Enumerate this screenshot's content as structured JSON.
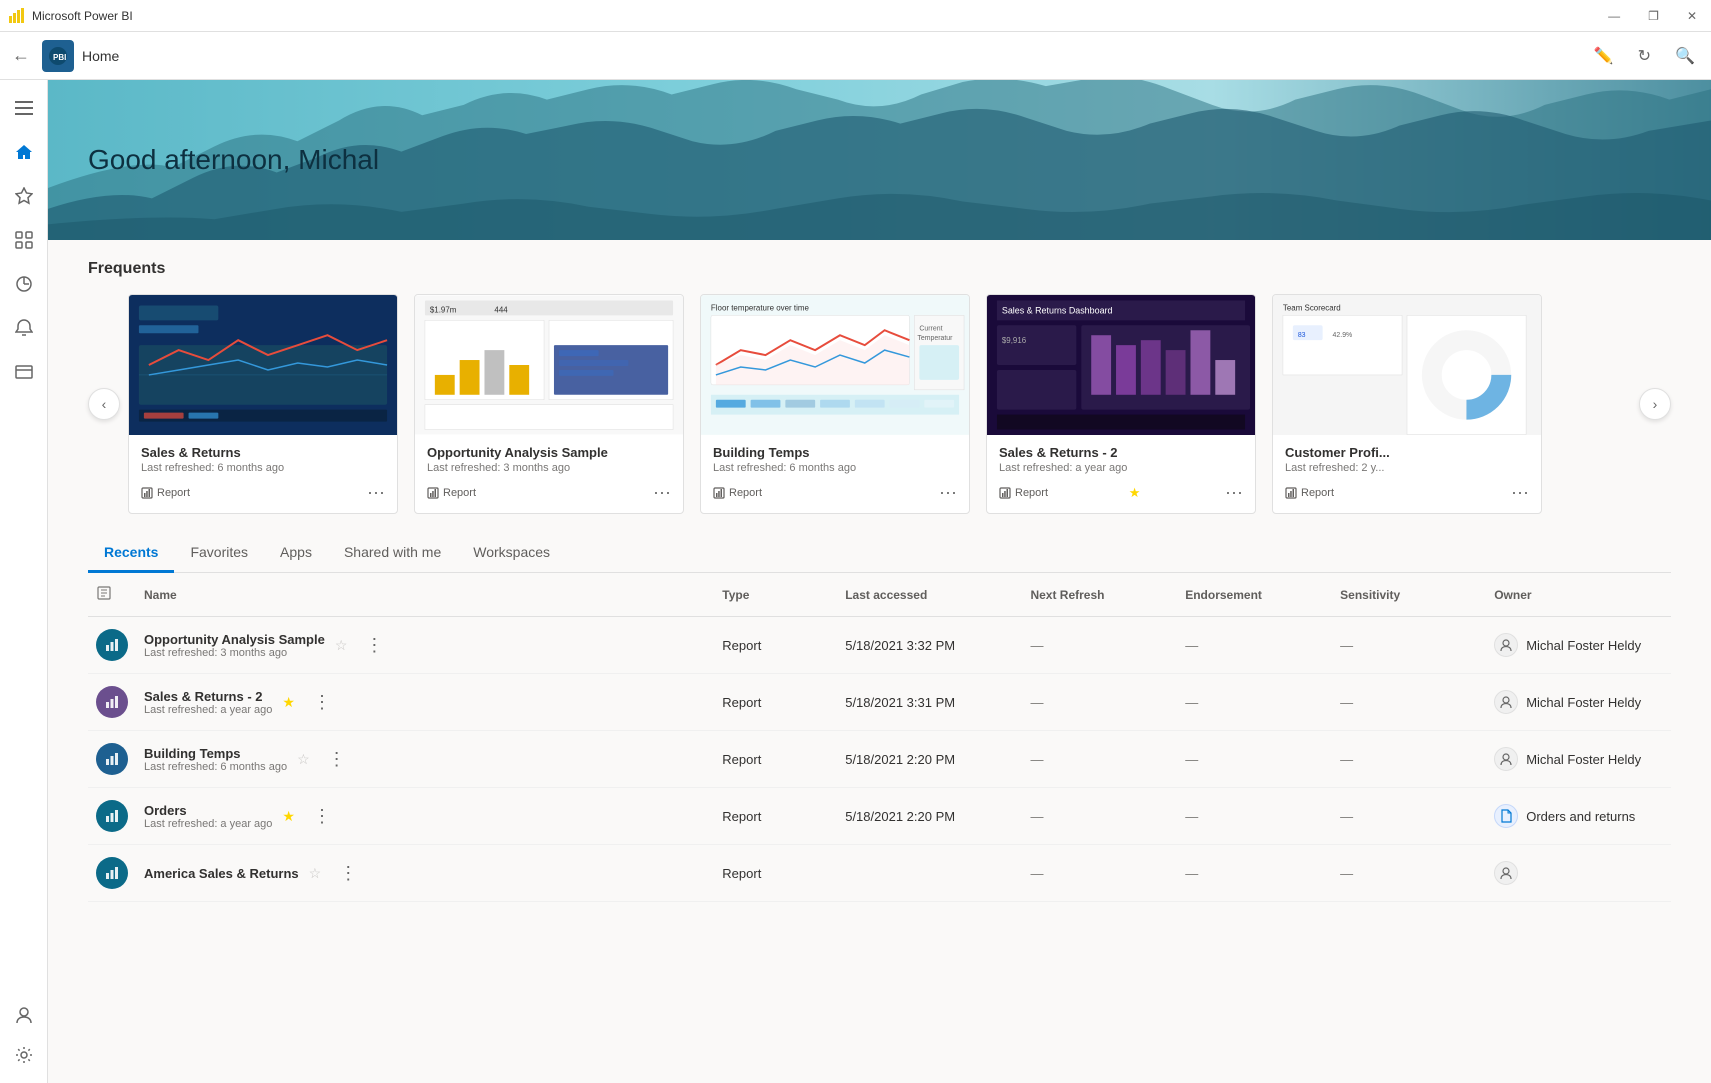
{
  "titlebar": {
    "title": "Microsoft Power BI",
    "minimize": "—",
    "restore": "❐",
    "close": "✕"
  },
  "topnav": {
    "back_label": "←",
    "page_title": "Home",
    "logo_text": "PBI",
    "icons": [
      "✎",
      "↻",
      "🔍"
    ]
  },
  "hero": {
    "greeting": "Good afternoon, Michal"
  },
  "sidebar": {
    "items": [
      {
        "icon": "☰",
        "name": "hamburger-menu"
      },
      {
        "icon": "⌂",
        "name": "home"
      },
      {
        "icon": "★",
        "name": "favorites"
      },
      {
        "icon": "⊞",
        "name": "apps"
      },
      {
        "icon": "🔍",
        "name": "search"
      },
      {
        "icon": "🔔",
        "name": "notifications"
      },
      {
        "icon": "◫",
        "name": "workspaces"
      }
    ],
    "bottom_items": [
      {
        "icon": "👤",
        "name": "account"
      },
      {
        "icon": "⚙",
        "name": "settings"
      }
    ]
  },
  "frequents": {
    "title": "Frequents",
    "cards": [
      {
        "id": "card-1",
        "title": "Sales & Returns",
        "subtitle": "Last refreshed: 6 months ago",
        "type": "Report",
        "starred": false,
        "color": "#1a3a6b",
        "thumb_type": "dashboard-blue"
      },
      {
        "id": "card-2",
        "title": "Opportunity Analysis Sample",
        "subtitle": "Last refreshed: 3 months ago",
        "type": "Report",
        "starred": false,
        "color": "#1a3a6b",
        "thumb_type": "dashboard-bar"
      },
      {
        "id": "card-3",
        "title": "Building Temps",
        "subtitle": "Last refreshed: 6 months ago",
        "type": "Report",
        "starred": false,
        "color": "#1a8a6b",
        "thumb_type": "dashboard-line"
      },
      {
        "id": "card-4",
        "title": "Sales & Returns  - 2",
        "subtitle": "Last refreshed: a year ago",
        "type": "Report",
        "starred": true,
        "color": "#6b1a8a",
        "thumb_type": "dashboard-purple"
      },
      {
        "id": "card-5",
        "title": "Customer Profi...",
        "subtitle": "Last refreshed: 2 y...",
        "type": "Report",
        "starred": false,
        "color": "#1a6b3a",
        "thumb_type": "dashboard-mixed"
      }
    ]
  },
  "tabs": {
    "items": [
      {
        "label": "Recents",
        "active": true
      },
      {
        "label": "Favorites",
        "active": false
      },
      {
        "label": "Apps",
        "active": false
      },
      {
        "label": "Shared with me",
        "active": false
      },
      {
        "label": "Workspaces",
        "active": false
      }
    ]
  },
  "table": {
    "headers": [
      "",
      "Name",
      "Type",
      "Last accessed",
      "Next Refresh",
      "Endorsement",
      "Sensitivity",
      "Owner"
    ],
    "rows": [
      {
        "id": "row-1",
        "icon_color": "teal",
        "icon_char": "📊",
        "name": "Opportunity Analysis Sample",
        "subtitle": "Last refreshed: 3 months ago",
        "starred": false,
        "type": "Report",
        "accessed": "5/18/2021 3:32 PM",
        "next_refresh": "—",
        "endorsement": "—",
        "sensitivity": "—",
        "owner": "Michal Foster Heldy",
        "owner_type": "user"
      },
      {
        "id": "row-2",
        "icon_color": "purple",
        "icon_char": "📊",
        "name": "Sales & Returns  - 2",
        "subtitle": "Last refreshed: a year ago",
        "starred": true,
        "type": "Report",
        "accessed": "5/18/2021 3:31 PM",
        "next_refresh": "—",
        "endorsement": "—",
        "sensitivity": "—",
        "owner": "Michal Foster Heldy",
        "owner_type": "user"
      },
      {
        "id": "row-3",
        "icon_color": "blue",
        "icon_char": "📊",
        "name": "Building Temps",
        "subtitle": "Last refreshed: 6 months ago",
        "starred": false,
        "type": "Report",
        "accessed": "5/18/2021 2:20 PM",
        "next_refresh": "—",
        "endorsement": "—",
        "sensitivity": "—",
        "owner": "Michal Foster Heldy",
        "owner_type": "user"
      },
      {
        "id": "row-4",
        "icon_color": "teal",
        "icon_char": "📊",
        "name": "Orders",
        "subtitle": "Last refreshed: a year ago",
        "starred": true,
        "type": "Report",
        "accessed": "5/18/2021 2:20 PM",
        "next_refresh": "—",
        "endorsement": "—",
        "sensitivity": "—",
        "owner": "Orders and returns",
        "owner_type": "file"
      },
      {
        "id": "row-5",
        "icon_color": "teal",
        "icon_char": "📊",
        "name": "America Sales & Returns",
        "subtitle": "",
        "starred": false,
        "type": "Report",
        "accessed": "",
        "next_refresh": "—",
        "endorsement": "—",
        "sensitivity": "—",
        "owner": "",
        "owner_type": "user"
      }
    ]
  },
  "colors": {
    "accent": "#0078d4",
    "tab_active": "#0078d4",
    "hero_text": "#1a3a4a"
  }
}
